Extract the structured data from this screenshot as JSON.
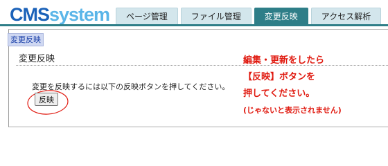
{
  "logo": {
    "part1": "CMS",
    "part2": "system"
  },
  "tabs": [
    {
      "label": "ページ管理",
      "active": false
    },
    {
      "label": "ファイル管理",
      "active": false
    },
    {
      "label": "変更反映",
      "active": true
    },
    {
      "label": "アクセス解析",
      "active": false
    }
  ],
  "breadcrumb": "変更反映",
  "section_title": "変更反映",
  "instruction": "変更を反映するには以下の反映ボタンを押してください。",
  "reflect_button_label": "反映",
  "annotation": {
    "line1": "編集・更新をしたら",
    "line2": "【反映】ボタンを",
    "line3": "押してください。",
    "line4": "(じゃないと表示されません)",
    "color": "#e0190f"
  },
  "colors": {
    "active_tab": "#2e7e88",
    "tab": "#d3e6ec",
    "logo_cms": "#1b62b9",
    "logo_system": "#5ab5e8"
  }
}
